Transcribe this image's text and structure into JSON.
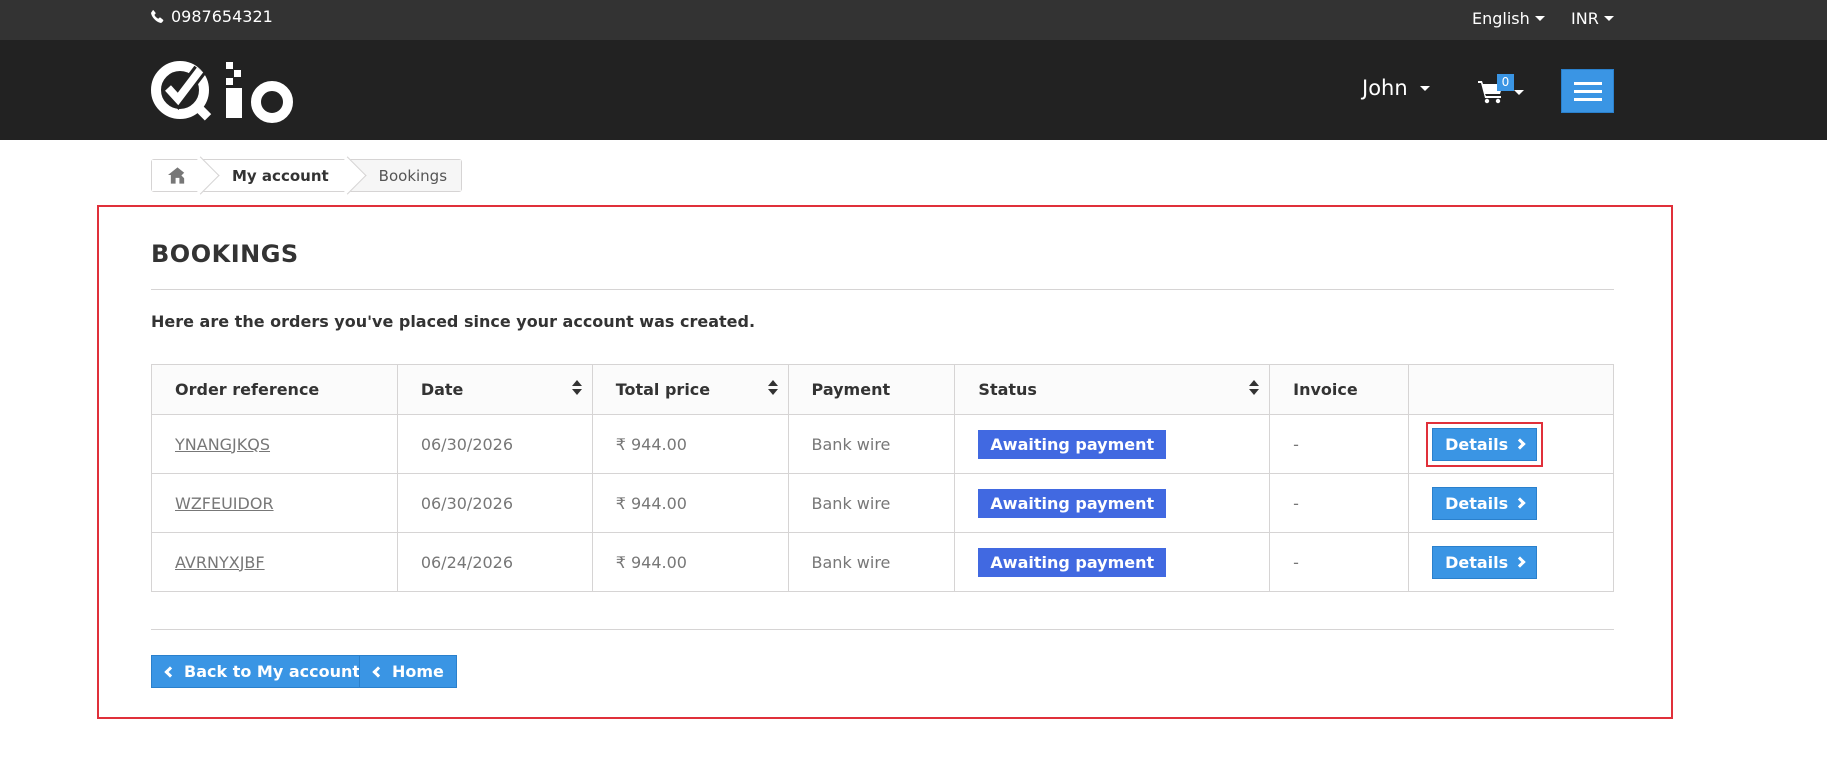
{
  "topbar": {
    "phone": "0987654321",
    "language": "English",
    "currency": "INR"
  },
  "header": {
    "user_name": "John",
    "cart_count": "0"
  },
  "breadcrumb": {
    "items": [
      "My account",
      "Bookings"
    ]
  },
  "page": {
    "title": "BOOKINGS",
    "intro": "Here are the orders you've placed since your account was created."
  },
  "table": {
    "headers": [
      "Order reference",
      "Date",
      "Total price",
      "Payment",
      "Status",
      "Invoice",
      ""
    ],
    "rows": [
      {
        "reference": "YNANGJKQS",
        "date": "06/30/2026",
        "total": "₹ 944.00",
        "payment": "Bank wire",
        "status": "Awaiting payment",
        "invoice": "-",
        "action": "Details"
      },
      {
        "reference": "WZFEUIDOR",
        "date": "06/30/2026",
        "total": "₹ 944.00",
        "payment": "Bank wire",
        "status": "Awaiting payment",
        "invoice": "-",
        "action": "Details"
      },
      {
        "reference": "AVRNYXJBF",
        "date": "06/24/2026",
        "total": "₹ 944.00",
        "payment": "Bank wire",
        "status": "Awaiting payment",
        "invoice": "-",
        "action": "Details"
      }
    ]
  },
  "footer_buttons": {
    "back": "Back to My account",
    "home": "Home"
  },
  "colors": {
    "accent": "#3a95e4",
    "status": "#4169e1",
    "highlight": "#e0303a",
    "header_bg": "#222222",
    "topbar_bg": "#333333"
  },
  "icons": [
    "phone-icon",
    "caret-down-icon",
    "logo",
    "cart-icon",
    "hamburger-icon",
    "home-icon",
    "sort-icon",
    "chevron-right-icon",
    "chevron-left-icon"
  ]
}
